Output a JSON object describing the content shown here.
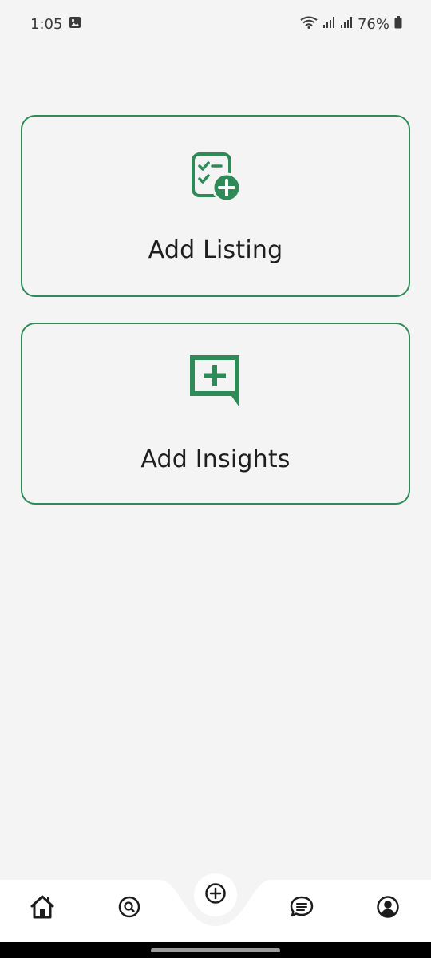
{
  "status_bar": {
    "time": "1:05",
    "battery_percent": "76%",
    "icons": [
      "image-notification-icon",
      "wifi-icon",
      "signal-icon",
      "signal-icon",
      "battery-icon"
    ]
  },
  "cards": [
    {
      "label": "Add Listing",
      "icon": "add-listing-checklist-icon"
    },
    {
      "label": "Add Insights",
      "icon": "add-insight-chat-icon"
    }
  ],
  "bottom_nav": {
    "items": [
      "home-icon",
      "search-icon",
      "add-icon",
      "chat-icon",
      "profile-icon"
    ]
  },
  "colors": {
    "accent": "#2e8b57",
    "background": "#f4f4f4",
    "nav_background": "#ffffff"
  }
}
